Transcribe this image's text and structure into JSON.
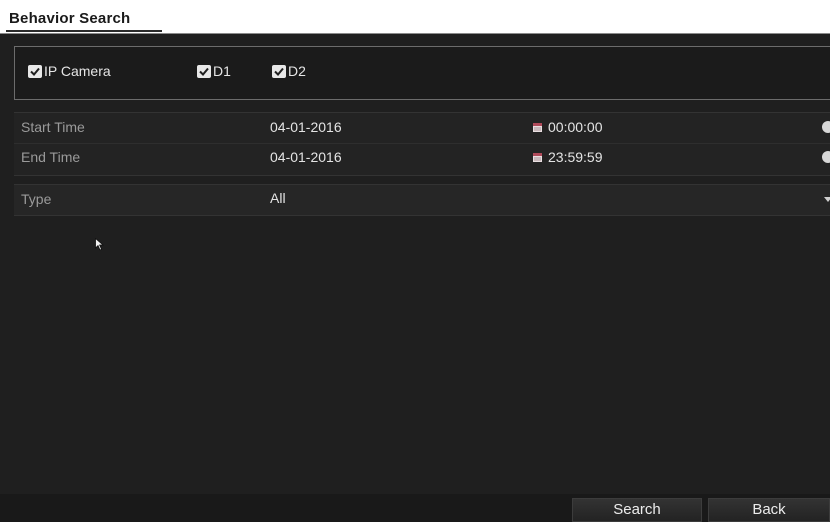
{
  "header": {
    "title": "Behavior Search"
  },
  "cameras": {
    "ip_camera_label": "IP Camera",
    "ip_camera_checked": true,
    "channels": [
      {
        "label": "D1",
        "checked": true
      },
      {
        "label": "D2",
        "checked": true
      }
    ]
  },
  "time": {
    "start_label": "Start Time",
    "start_date": "04-01-2016",
    "start_clock": "00:00:00",
    "end_label": "End Time",
    "end_date": "04-01-2016",
    "end_clock": "23:59:59"
  },
  "type": {
    "label": "Type",
    "value": "All"
  },
  "buttons": {
    "search": "Search",
    "back": "Back"
  },
  "icons": {
    "checkbox": "checkbox-checked-icon",
    "calendar": "calendar-icon",
    "clock": "clock-icon",
    "dropdown": "chevron-down-icon",
    "cursor": "mouse-pointer-icon"
  },
  "colors": {
    "background": "#1f1f1f",
    "panel": "#232323",
    "calendar_accent": "#b04a5a",
    "text": "#e4e4e4",
    "muted_text": "#9a9a9a"
  }
}
